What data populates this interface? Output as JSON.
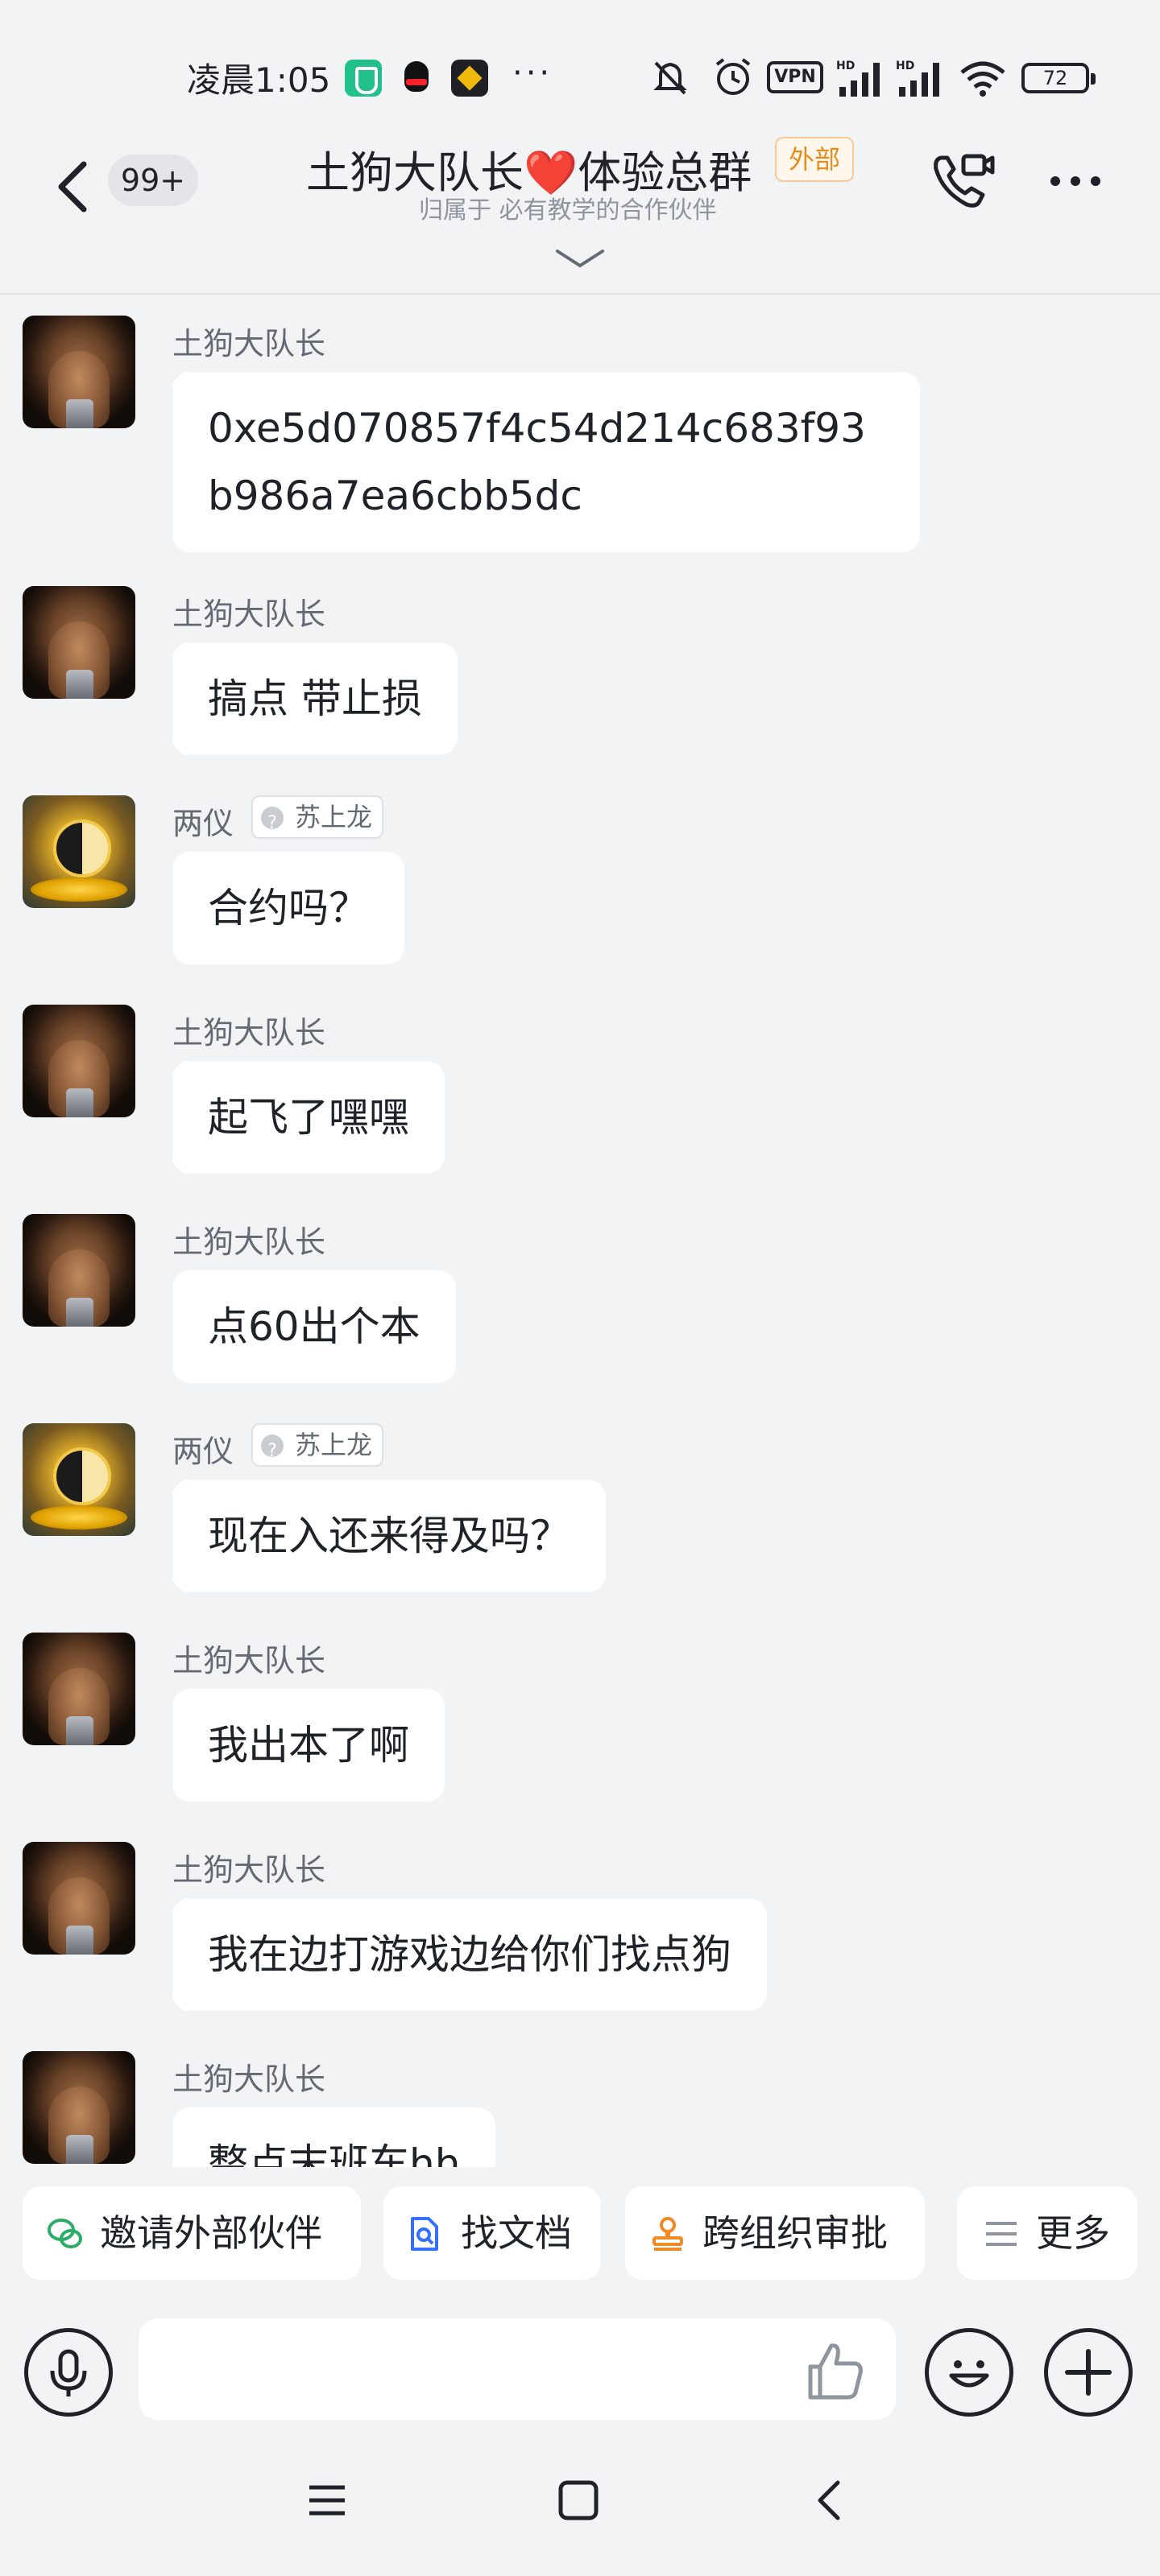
{
  "status_bar": {
    "time": "凌晨1:05",
    "more": "···",
    "vpn": "VPN",
    "battery": "72"
  },
  "header": {
    "unread_count": "99+",
    "title_prefix": "土狗大队长",
    "title_heart": "❤️",
    "title_suffix": "体验总群",
    "external_tag": "外部",
    "subtitle": "归属于 必有教学的合作伙伴"
  },
  "messages": [
    {
      "sender": "土狗大队长",
      "avatar": "warrior-avatar",
      "org": "",
      "text": "0xe5d070857f4c54d214c683f93b986a7ea6cbb5dc"
    },
    {
      "sender": "土狗大队长",
      "avatar": "warrior-avatar",
      "org": "",
      "text": "搞点 带止损"
    },
    {
      "sender": "两仪",
      "avatar": "taiji-avatar",
      "org": "苏上龙",
      "text": "合约吗？"
    },
    {
      "sender": "土狗大队长",
      "avatar": "warrior-avatar",
      "org": "",
      "text": "起飞了嘿嘿"
    },
    {
      "sender": "土狗大队长",
      "avatar": "warrior-avatar",
      "org": "",
      "text": "点60出个本"
    },
    {
      "sender": "两仪",
      "avatar": "taiji-avatar",
      "org": "苏上龙",
      "text": "现在入还来得及吗？"
    },
    {
      "sender": "土狗大队长",
      "avatar": "warrior-avatar",
      "org": "",
      "text": "我出本了啊"
    },
    {
      "sender": "土狗大队长",
      "avatar": "warrior-avatar",
      "org": "",
      "text": "我在边打游戏边给你们找点狗"
    },
    {
      "sender": "土狗大队长",
      "avatar": "warrior-avatar",
      "org": "",
      "text": "整点末班车hh"
    }
  ],
  "quick_actions": [
    {
      "label": "邀请外部伙伴",
      "icon": "wechat-icon",
      "color": "#2aae67"
    },
    {
      "label": "找文档",
      "icon": "doc-search-icon",
      "color": "#3370ff"
    },
    {
      "label": "跨组织审批",
      "icon": "approval-stamp-icon",
      "color": "#f08a24"
    },
    {
      "label": "更多",
      "icon": "list-icon",
      "color": "#8f959e"
    }
  ],
  "input": {
    "value": "",
    "placeholder": ""
  }
}
